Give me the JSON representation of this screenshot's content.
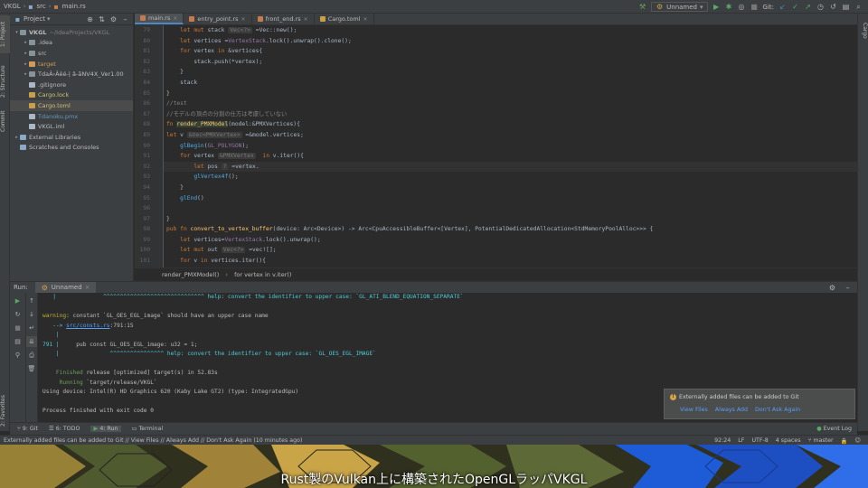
{
  "titlebar": {
    "breadcrumbs": [
      "VKGL",
      "src",
      "main.rs"
    ],
    "run_config": "Unnamed",
    "vcs_label": "Git:"
  },
  "left_stripe": {
    "tabs": [
      "1: Project",
      "2: Structure",
      "Commit",
      "2: Favorites"
    ]
  },
  "right_stripe": {
    "tabs": [
      "Cargo"
    ]
  },
  "project_panel": {
    "title": "Project",
    "tree": [
      {
        "label": "VKGL",
        "hint": "~/IdeaProjects/VKGL",
        "depth": 0,
        "arrow": "▾",
        "icon": "folder",
        "bold": true
      },
      {
        "label": ".idea",
        "depth": 1,
        "arrow": "▸",
        "icon": "folder"
      },
      {
        "label": "src",
        "depth": 1,
        "arrow": "▸",
        "icon": "folder"
      },
      {
        "label": "target",
        "depth": 1,
        "arrow": "▸",
        "icon": "folder-excluded",
        "dim": true
      },
      {
        "label": "TdaÂ›Âëé-| â-ãNV4X_Ver1.00",
        "depth": 1,
        "arrow": "▸",
        "icon": "folder"
      },
      {
        "label": ".gitignore",
        "depth": 1,
        "arrow": "",
        "icon": "file"
      },
      {
        "label": "Cargo.lock",
        "depth": 1,
        "arrow": "",
        "icon": "file-cargo"
      },
      {
        "label": "Cargo.toml",
        "depth": 1,
        "arrow": "",
        "icon": "file-cargo",
        "selected": true
      },
      {
        "label": "Tdanoku.pmx",
        "depth": 1,
        "arrow": "",
        "icon": "file",
        "dim": true
      },
      {
        "label": "VKGL.iml",
        "depth": 1,
        "arrow": "",
        "icon": "file"
      },
      {
        "label": "External Libraries",
        "depth": 0,
        "arrow": "▸",
        "icon": "library"
      },
      {
        "label": "Scratches and Consoles",
        "depth": 0,
        "arrow": "",
        "icon": "scratch"
      }
    ]
  },
  "editor": {
    "tabs": [
      {
        "label": "main.rs",
        "active": true
      },
      {
        "label": "entry_point.rs",
        "active": false
      },
      {
        "label": "front_end.rs",
        "active": false
      },
      {
        "label": "Cargo.toml",
        "active": false
      }
    ],
    "lines": [
      {
        "n": "79",
        "html": "    <span class='kw'>let mut</span> stack <span class='hint'>Vec&lt;?&gt;</span> =Vec::new();"
      },
      {
        "n": "80",
        "html": "    <span class='kw'>let</span> vertices =<span class='st'>VertexStack</span>.lock().unwrap().clone();"
      },
      {
        "n": "81",
        "html": "    <span class='kw'>for</span> vertex <span class='kw'>in</span> &amp;vertices{"
      },
      {
        "n": "82",
        "html": "        stack.push(*vertex);"
      },
      {
        "n": "83",
        "html": "    }"
      },
      {
        "n": "84",
        "html": "    stack"
      },
      {
        "n": "85",
        "html": "}"
      },
      {
        "n": "86",
        "html": "<span class='cm'>//test</span>"
      },
      {
        "n": "87",
        "html": "<span class='cm'>//モデルの頂点の分割の仕方は考慮していない</span>"
      },
      {
        "n": "88",
        "html": "<span class='kw'>fn</span> <span class='fn hl'>render_PMXModel</span>(model:&amp;PMXVertices){"
      },
      {
        "n": "89",
        "html": "<span class='kw'>let</span> v <span class='hint'>&amp;Vec&lt;PMXVertex&gt;</span> =&amp;model.vertices;"
      },
      {
        "n": "90",
        "html": "    <span class='mac'>glBegin</span>(<span class='st'>GL_POLYGON</span>);"
      },
      {
        "n": "91",
        "html": "    <span class='kw'>for</span> vertex <span class='hint'>&amp;PMXVertex</span>  <span class='kw'>in</span> v.iter(){"
      },
      {
        "n": "92",
        "html": "        <span class='kw'>let</span> pos <span class='hint'>?</span> =vertex.",
        "current": true
      },
      {
        "n": "93",
        "html": "        <span class='mac'>glVertex4f</span>();"
      },
      {
        "n": "94",
        "html": "    }"
      },
      {
        "n": "95",
        "html": "    <span class='mac'>glEnd</span>()"
      },
      {
        "n": "96",
        "html": ""
      },
      {
        "n": "97",
        "html": "}"
      },
      {
        "n": "98",
        "html": "<span class='kw'>pub fn</span> <span class='fn'>convert_to_vertex_buffer</span>(device: Arc&lt;Device&gt;) -&gt; Arc&lt;CpuAccessibleBuffer&lt;[Vertex], PotentialDedicatedAllocation&lt;StdMemoryPoolAlloc&gt;&gt;&gt; {"
      },
      {
        "n": "99",
        "html": "    <span class='kw'>let</span> vertices=<span class='st'>VertexStack</span>.lock().unwrap();"
      },
      {
        "n": "100",
        "html": "    <span class='kw'>let mut</span> out <span class='hint'>Vec&lt;?&gt;</span> =vec![];"
      },
      {
        "n": "101",
        "html": "    <span class='kw'>for</span> v <span class='kw'>in</span> vertices.iter(){"
      },
      {
        "n": "102",
        "html": "        out.push(*v);"
      },
      {
        "n": "103",
        "html": "    }"
      },
      {
        "n": "104",
        "html": "CpuAccessibleBuffer::from_iter(device.clone(), BufferUsage::all(), false, out.iter().cloned()).unwrap()"
      }
    ],
    "breadcrumb": [
      "render_PMXModel()",
      "for vertex in v.iter()"
    ]
  },
  "run_panel": {
    "label": "Run:",
    "tab": "Unnamed",
    "console": [
      {
        "cls": "",
        "html": "   <span class='cyan'>|              ^^^^^^^^^^^^^^^^^^^^^^^^^^^^^^ help: convert the identifier to upper case: `GL_ATI_BLEND_EQUATION_SEPARATE`</span>"
      },
      {
        "cls": "",
        "html": ""
      },
      {
        "cls": "",
        "html": "<span class='warn'>warning</span>: constant `GL_OES_EGL_image` should have an upper case name"
      },
      {
        "cls": "",
        "html": "   <span class='cyan'>--&gt;</span> <span class='link'>src/consts.rs</span>:791:15"
      },
      {
        "cls": "",
        "html": "    <span class='cyan'>|</span>"
      },
      {
        "cls": "",
        "html": "<span class='cyan'>791 |</span>     pub const GL_OES_EGL_image: u32 = 1;"
      },
      {
        "cls": "",
        "html": "    <span class='cyan'>|</span>               <span class='cyan'>^^^^^^^^^^^^^^^^ help: convert the identifier to upper case: `GL_OES_EGL_IMAGE`</span>"
      },
      {
        "cls": "",
        "html": ""
      },
      {
        "cls": "",
        "html": "    <span class='grn'>Finished</span> release [optimized] target(s) in 52.83s"
      },
      {
        "cls": "",
        "html": "     <span class='grn'>Running</span> `target/release/VKGL`"
      },
      {
        "cls": "",
        "html": "Using device: Intel(R) HD Graphics 620 (Kaby Lake GT2) (type: IntegratedGpu)"
      },
      {
        "cls": "",
        "html": ""
      },
      {
        "cls": "",
        "html": "Process finished with exit code 0"
      }
    ]
  },
  "notification": {
    "text": "Externally added files can be added to Git",
    "actions": [
      "View Files",
      "Always Add",
      "Don't Ask Again"
    ]
  },
  "tool_strip": {
    "items": [
      "9: Git",
      "6: TODO",
      "4: Run",
      "Terminal"
    ],
    "right": "Event Log"
  },
  "status_bar": {
    "message": "Externally added files can be added to Git // View Files // Always Add // Don't Ask Again (10 minutes ago)",
    "position": "92:24",
    "line_sep": "LF",
    "encoding": "UTF-8",
    "indent": "4 spaces",
    "branch": "master"
  },
  "subtitle": "Rust製のVulkan上に構築されたOpenGLラッパVKGL",
  "colors": {
    "accent": "#4a88c7",
    "keyword": "#cc7832",
    "warning": "#bbb529",
    "notification_link": "#589df6"
  }
}
